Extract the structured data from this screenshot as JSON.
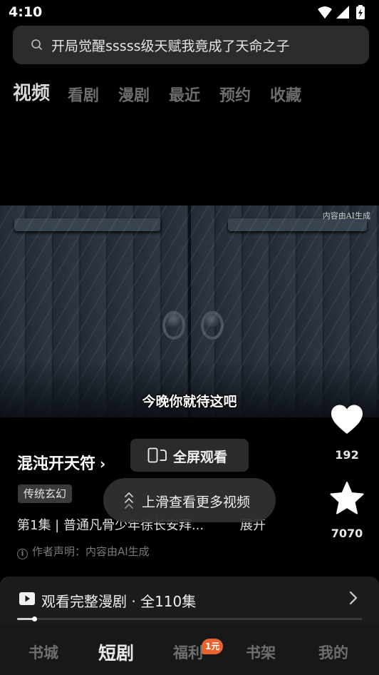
{
  "status_bar": {
    "time": "4:10",
    "icons": [
      "wifi-icon",
      "signal-icon",
      "battery-charging-icon"
    ]
  },
  "search": {
    "query": "开局觉醒sssss级天赋我竟成了天命之子",
    "icon": "search-icon"
  },
  "top_tabs": [
    {
      "label": "视频",
      "active": true
    },
    {
      "label": "看剧",
      "active": false
    },
    {
      "label": "漫剧",
      "active": false
    },
    {
      "label": "最近",
      "active": false
    },
    {
      "label": "预约",
      "active": false
    },
    {
      "label": "收藏",
      "active": false
    }
  ],
  "video": {
    "watermark": "内容由AI生成",
    "subtitle": "今晚你就待这吧"
  },
  "actions": {
    "like_count": "192",
    "favorite_count": "7070"
  },
  "series": {
    "title": "混沌开天符",
    "title_chevron": "›",
    "genre_tag": "传统玄幻",
    "episode_desc": "第1集 | 普通凡骨少年徐长安拜...",
    "expand_label": "展开",
    "ai_notice": "作者声明：内容由AI生成"
  },
  "fullscreen_button": {
    "label": "全屏观看",
    "icon": "rotate-fullscreen-icon"
  },
  "swipe_hint": {
    "label": "上滑查看更多视频",
    "icon": "double-chevron-up-icon"
  },
  "full_series": {
    "label": "观看完整漫剧 · 全110集",
    "icon": "play-icon",
    "progress": 0.05
  },
  "bottom_nav": [
    {
      "label": "书城",
      "active": false
    },
    {
      "label": "短剧",
      "active": true
    },
    {
      "label": "福利",
      "active": false,
      "badge": "1元"
    },
    {
      "label": "书架",
      "active": false
    },
    {
      "label": "我的",
      "active": false
    }
  ],
  "colors": {
    "background": "#000000",
    "badge": "#e9632f",
    "panel": "#1c1c1c"
  }
}
